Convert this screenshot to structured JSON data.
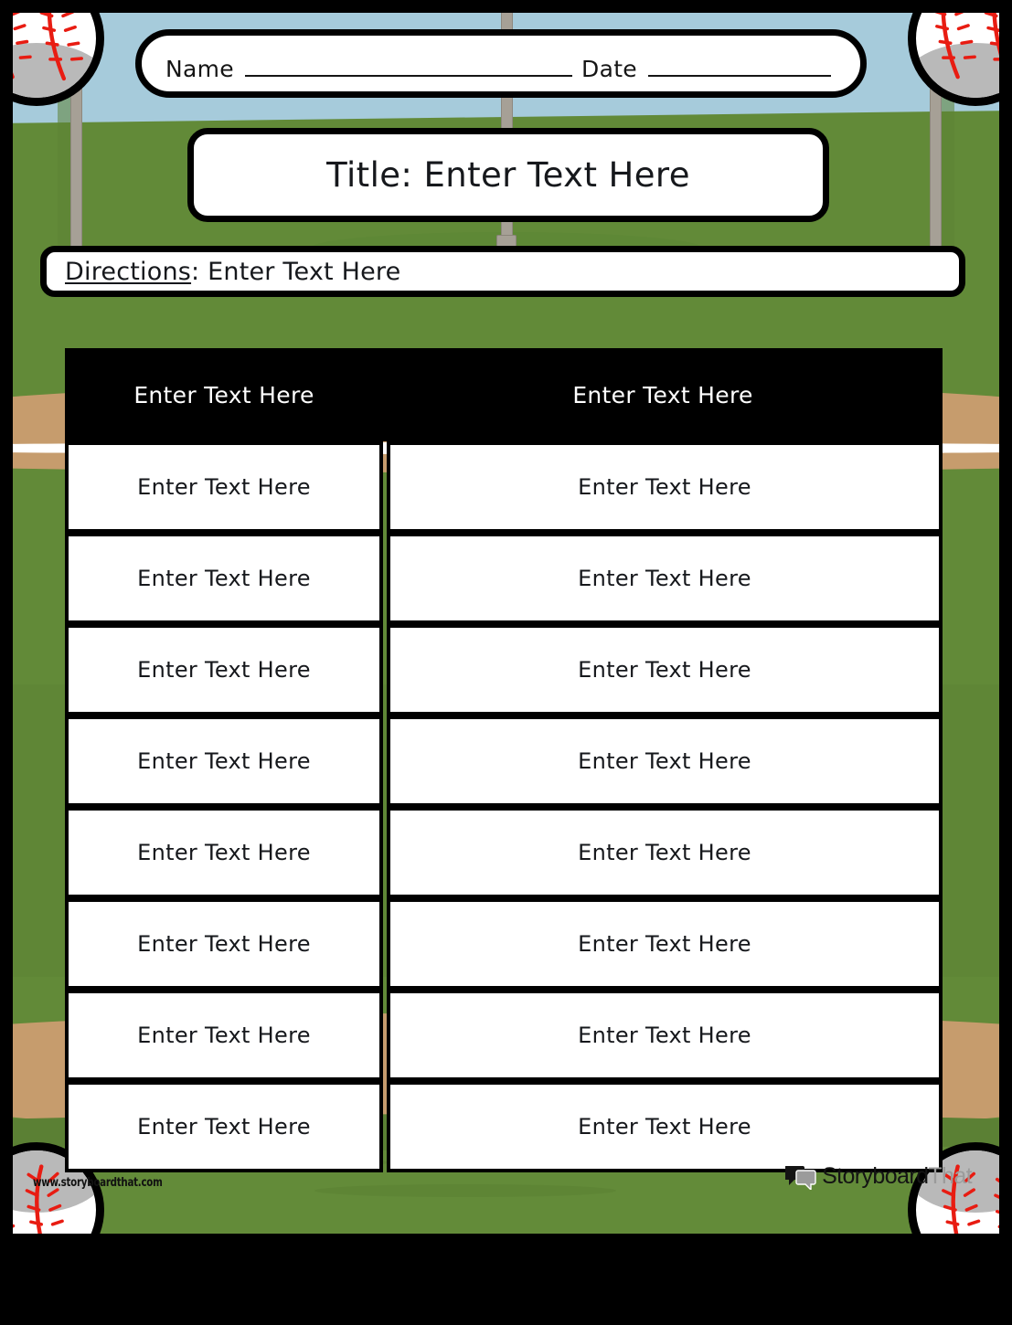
{
  "meta": {
    "worksheet_kind": "baseball-themed two-column worksheet template",
    "placeholder": "Enter Text Here"
  },
  "colors": {
    "page_border": "#000000",
    "sky": "#a6cbdb",
    "grass": "#628a38",
    "grass_dark": "#5f8636",
    "infield_dirt": "#c69c6d",
    "base_line": "#ffffff",
    "pole": "#a6a096",
    "panel_bg": "#ffffff",
    "panel_border": "#000000",
    "table_header_bg": "#000000",
    "table_header_text": "#ffffff",
    "body_text": "#16181c",
    "seam_red": "#e81c12",
    "ball_white": "#ffffff",
    "ball_gray": "#b9b9b9",
    "brand_dark": "#141414",
    "brand_gray": "#9b9b9b"
  },
  "header": {
    "name_label": "Name",
    "date_label": "Date"
  },
  "title": {
    "text": "Title: Enter Text Here"
  },
  "directions": {
    "label": "Directions",
    "separator": ":",
    "value": "Enter Text Here"
  },
  "table": {
    "columns": [
      "Enter Text Here",
      "Enter Text Here"
    ],
    "rows": [
      [
        "Enter Text Here",
        "Enter Text Here"
      ],
      [
        "Enter Text Here",
        "Enter Text Here"
      ],
      [
        "Enter Text Here",
        "Enter Text Here"
      ],
      [
        "Enter Text Here",
        "Enter Text Here"
      ],
      [
        "Enter Text Here",
        "Enter Text Here"
      ],
      [
        "Enter Text Here",
        "Enter Text Here"
      ],
      [
        "Enter Text Here",
        "Enter Text Here"
      ],
      [
        "Enter Text Here",
        "Enter Text Here"
      ]
    ]
  },
  "footer": {
    "website": "www.storyboardthat.com",
    "brand_part1": "Storyboard",
    "brand_part2": "That"
  },
  "decorations": {
    "baseball_count": 4,
    "baseball_positions": [
      "top-left",
      "top-right",
      "bottom-left",
      "bottom-right"
    ],
    "pole_count": 3
  }
}
